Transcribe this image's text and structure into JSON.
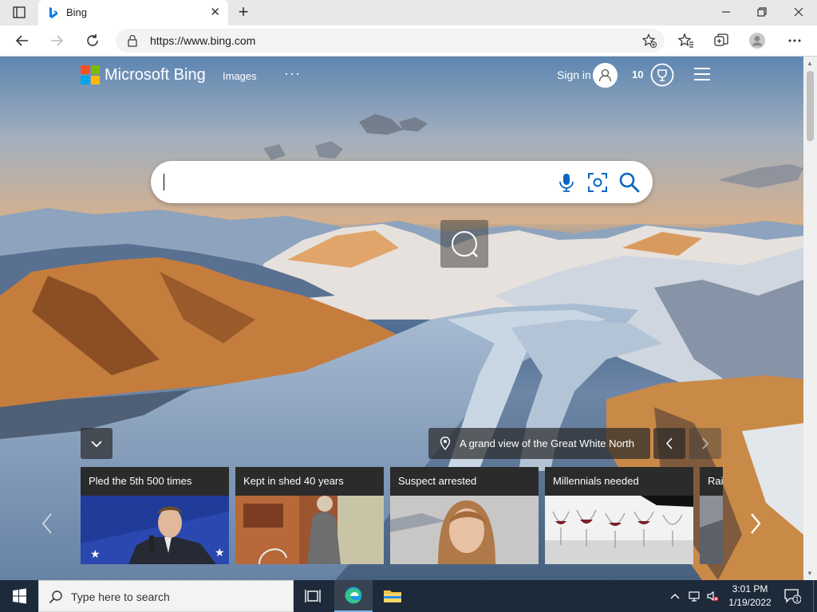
{
  "browser": {
    "tab": {
      "title": "Bing",
      "close_glyph": "✕",
      "favicon": "bing-logo-icon"
    },
    "new_tab_glyph": "+",
    "address": {
      "url": "https://www.bing.com"
    },
    "toolbar_icons": [
      "back-icon",
      "forward-icon",
      "refresh-icon",
      "lock-icon",
      "add-favorite-icon",
      "favorites-icon",
      "collections-icon",
      "profile-icon",
      "more-icon"
    ],
    "window_controls": [
      "minimize-icon",
      "maximize-icon",
      "close-icon"
    ]
  },
  "header": {
    "logo_text": "Microsoft Bing",
    "nav_images": "Images",
    "nav_more": "···",
    "sign_in": "Sign in",
    "points": "10",
    "logo_colors": [
      "#f25022",
      "#7fba00",
      "#00a4ef",
      "#ffb900"
    ]
  },
  "search": {
    "placeholder": "",
    "value": ""
  },
  "image_info": {
    "caption": "A grand view of the Great White North"
  },
  "cards": [
    {
      "title": "Pled the 5th 500 times"
    },
    {
      "title": "Kept in shed 40 years"
    },
    {
      "title": "Suspect arrested"
    },
    {
      "title": "Millennials needed"
    },
    {
      "title": "Rail"
    }
  ],
  "taskbar": {
    "search_text": "Type here to search",
    "time": "3:01 PM",
    "date": "1/19/2022",
    "notification_count": "1"
  },
  "colors": {
    "accent": "#0078d4",
    "taskbar": "#1c2a3a"
  }
}
